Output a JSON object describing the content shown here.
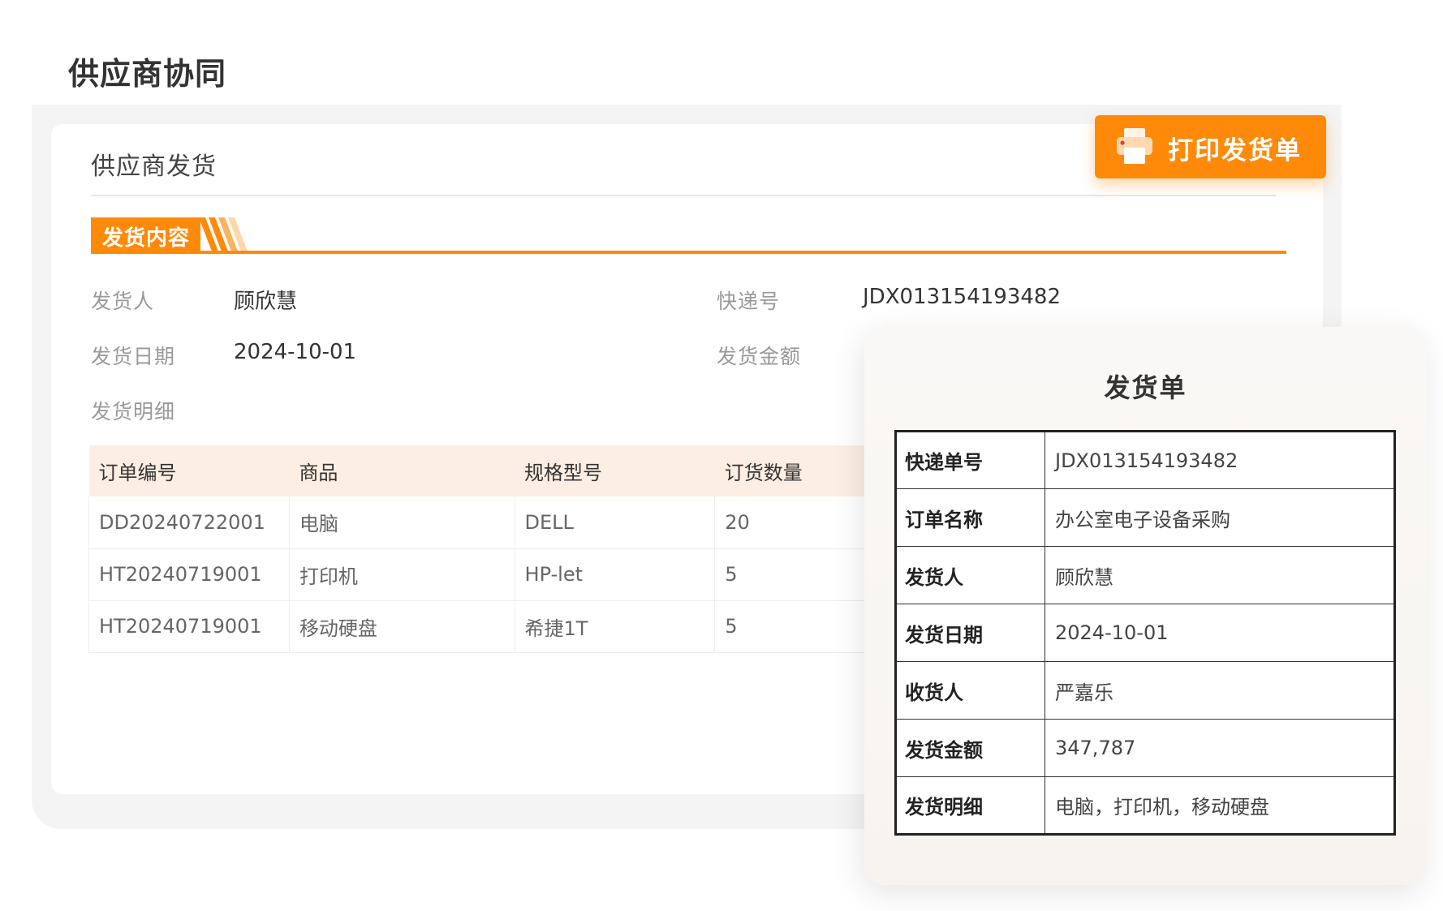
{
  "page": {
    "title": "供应商协同"
  },
  "card": {
    "title": "供应商发货",
    "print_button": "打印发货单",
    "section_tag": "发货内容"
  },
  "fields": {
    "shipper_label": "发货人",
    "shipper_value": "顾欣慧",
    "tracking_label": "快递号",
    "tracking_value": "JDX013154193482",
    "date_label": "发货日期",
    "date_value": "2024-10-01",
    "amount_label": "发货金额",
    "detail_label": "发货明细"
  },
  "detail_table": {
    "headers": [
      "订单编号",
      "商品",
      "规格型号",
      "订货数量"
    ],
    "rows": [
      [
        "DD20240722001",
        "电脑",
        "DELL",
        "20"
      ],
      [
        "HT20240719001",
        "打印机",
        "HP-let",
        "5"
      ],
      [
        "HT20240719001",
        "移动硬盘",
        "希捷1T",
        "5"
      ]
    ]
  },
  "receipt": {
    "title": "发货单",
    "rows": [
      {
        "key": "快递单号",
        "value": "JDX013154193482"
      },
      {
        "key": "订单名称",
        "value": "办公室电子设备采购"
      },
      {
        "key": "发货人",
        "value": "顾欣慧"
      },
      {
        "key": "发货日期",
        "value": "2024-10-01"
      },
      {
        "key": "收货人",
        "value": "严嘉乐"
      },
      {
        "key": "发货金额",
        "value": "347,787"
      },
      {
        "key": "发货明细",
        "value": "电脑，打印机，移动硬盘"
      }
    ]
  },
  "colors": {
    "accent": "#ff8a0a",
    "table_header_bg": "#fdeee3"
  },
  "icons": {
    "print_button_icon": "printer-icon"
  }
}
